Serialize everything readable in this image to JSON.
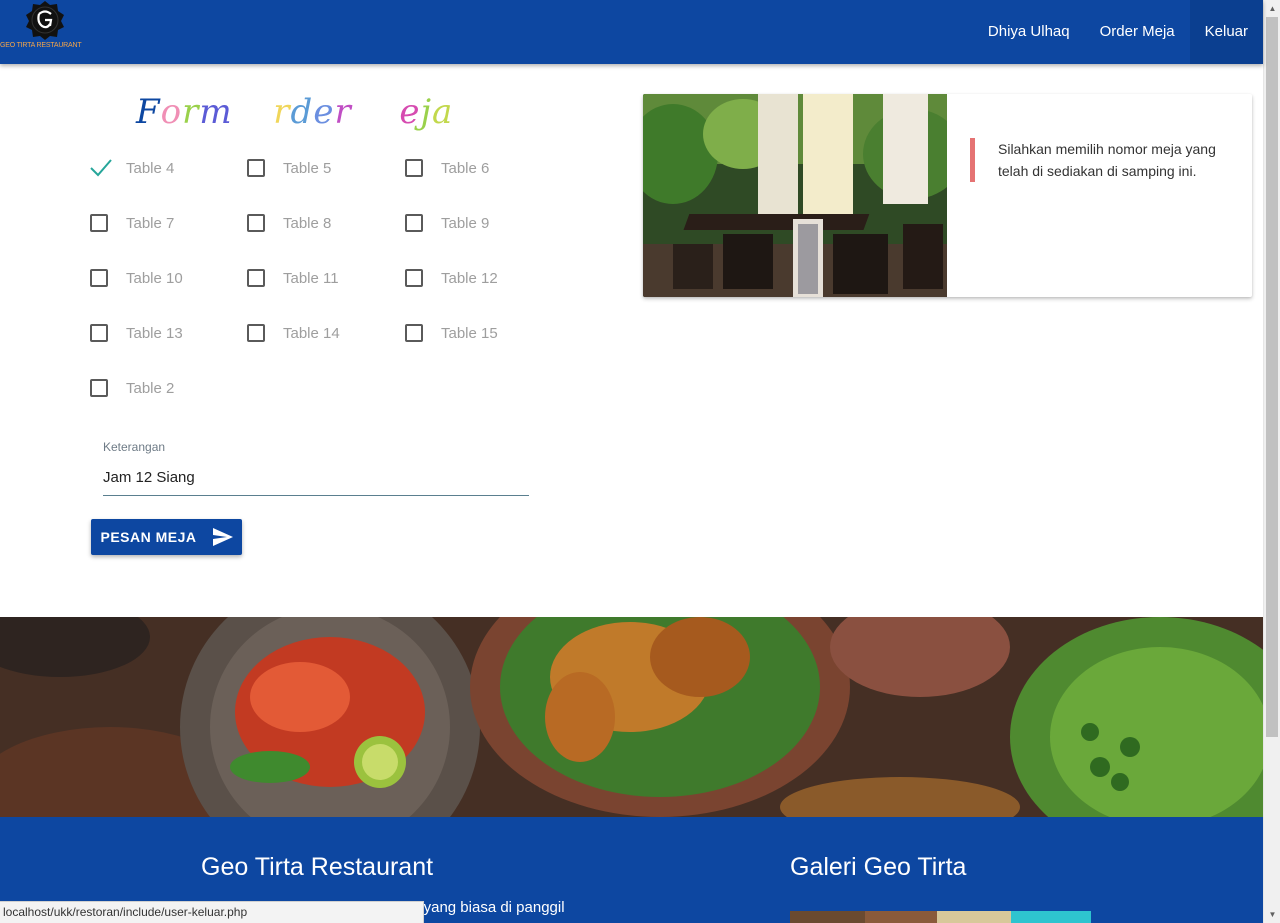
{
  "navbar": {
    "brand_text": "GEO TIRTA RESTAURANT",
    "links": [
      "Dhiya Ulhaq",
      "Order Meja",
      "Keluar"
    ],
    "background": "#0d47a1"
  },
  "form": {
    "title": "Form Order Meja",
    "title_colors": [
      "#0d47a1",
      "#f08fb5",
      "#9ad14b",
      "#5b5bd6",
      "#d983c6",
      "#ffffff",
      "#f0d65a",
      "#5b9bd6",
      "#6b8fe0",
      "#c04ec4",
      "#4fc3f7",
      "#ffffff",
      "#d64bb0",
      "#9ad14b",
      "#c2d84c",
      "#4fb3e0"
    ],
    "tables": [
      {
        "label": "Table 4",
        "checked": true
      },
      {
        "label": "Table 5",
        "checked": false
      },
      {
        "label": "Table 6",
        "checked": false
      },
      {
        "label": "Table 7",
        "checked": false
      },
      {
        "label": "Table 8",
        "checked": false
      },
      {
        "label": "Table 9",
        "checked": false
      },
      {
        "label": "Table 10",
        "checked": false
      },
      {
        "label": "Table 11",
        "checked": false
      },
      {
        "label": "Table 12",
        "checked": false
      },
      {
        "label": "Table 13",
        "checked": false
      },
      {
        "label": "Table 14",
        "checked": false
      },
      {
        "label": "Table 15",
        "checked": false
      },
      {
        "label": "Table 2",
        "checked": false
      }
    ],
    "keterangan_label": "Keterangan",
    "keterangan_value": "Jam 12 Siang",
    "submit_label": "PESAN MEJA",
    "accent": "#26a69a"
  },
  "info_card": {
    "text": "Silahkan memilih nomor meja yang telah di sediakan di samping ini.",
    "border_color": "#e57373"
  },
  "footer": {
    "title_left": "Geo Tirta Restaurant",
    "desc": "Restoran ini dikelola oleh pemilik yang biasa di panggil",
    "title_right": "Galeri Geo Tirta"
  },
  "status_bar": {
    "url": "localhost/ukk/restoran/include/user-keluar.php"
  }
}
